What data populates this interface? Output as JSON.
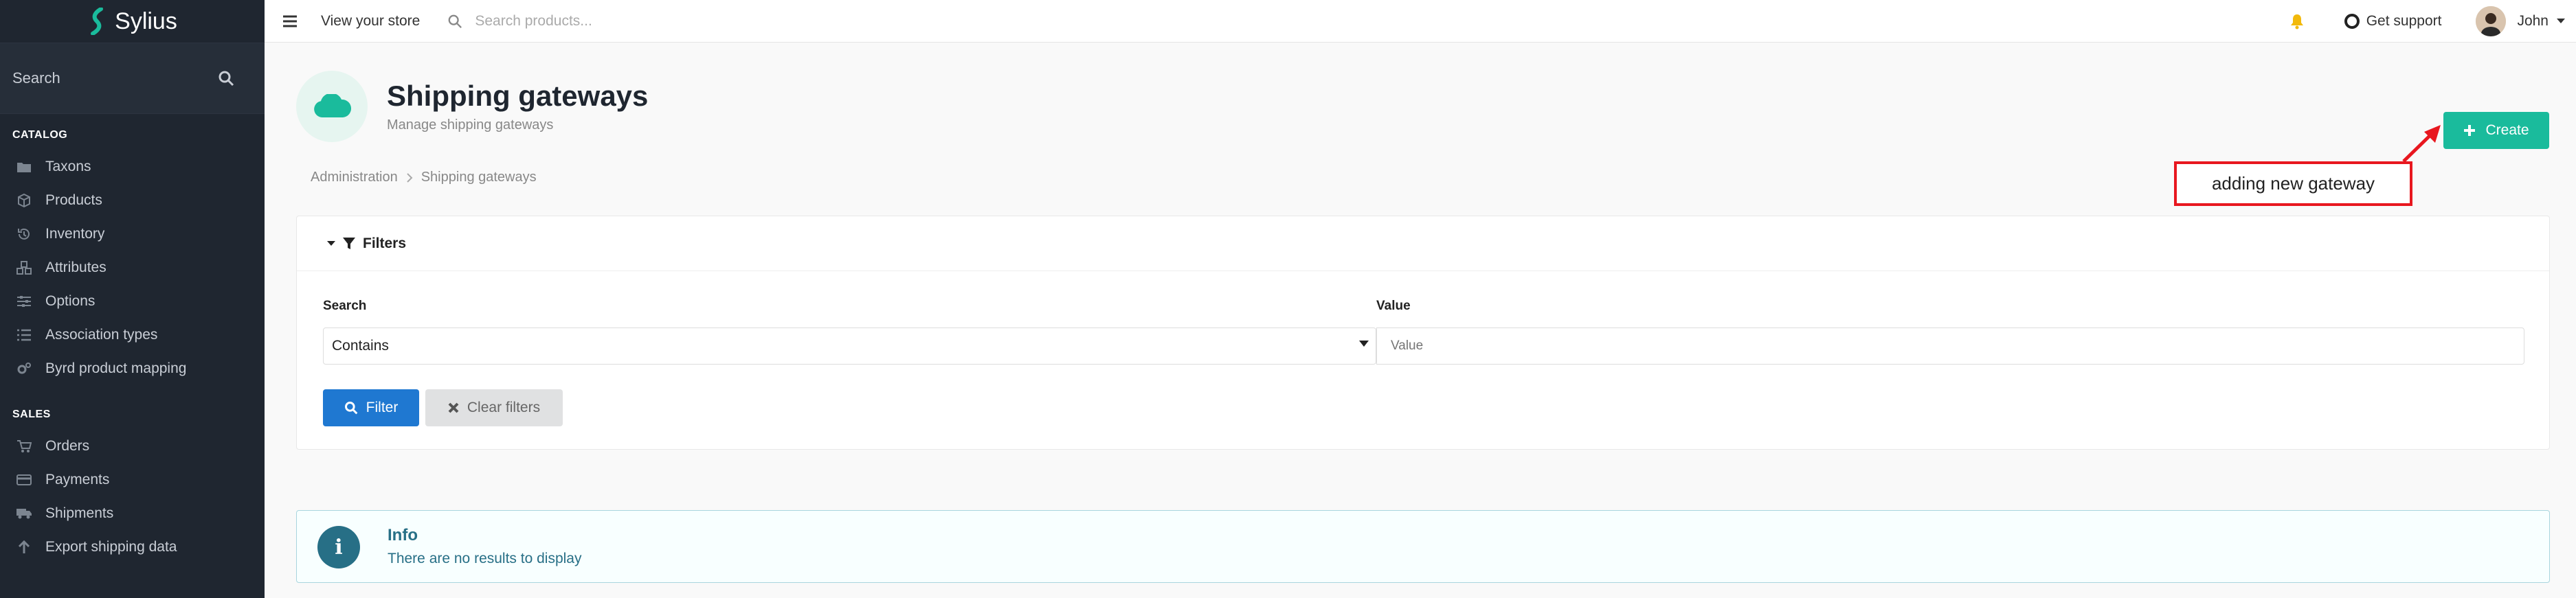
{
  "sidebar": {
    "brand": "Sylius",
    "search_label": "Search",
    "sections": [
      {
        "title": "CATALOG",
        "items": [
          {
            "label": "Taxons",
            "icon": "folder-icon"
          },
          {
            "label": "Products",
            "icon": "cube-icon"
          },
          {
            "label": "Inventory",
            "icon": "history-icon"
          },
          {
            "label": "Attributes",
            "icon": "cubes-icon"
          },
          {
            "label": "Options",
            "icon": "options-icon"
          },
          {
            "label": "Association types",
            "icon": "list-icon"
          },
          {
            "label": "Byrd product mapping",
            "icon": "cogs-icon"
          }
        ]
      },
      {
        "title": "SALES",
        "items": [
          {
            "label": "Orders",
            "icon": "cart-icon"
          },
          {
            "label": "Payments",
            "icon": "payment-icon"
          },
          {
            "label": "Shipments",
            "icon": "truck-icon"
          },
          {
            "label": "Export shipping data",
            "icon": "arrow-up-icon"
          }
        ]
      }
    ]
  },
  "topbar": {
    "view_store": "View your store",
    "search_placeholder": "Search products...",
    "support": "Get support",
    "user": "John"
  },
  "header": {
    "title": "Shipping gateways",
    "subtitle": "Manage shipping gateways",
    "breadcrumb": [
      "Administration",
      "Shipping gateways"
    ],
    "create_label": "Create"
  },
  "annotation": "adding new gateway",
  "filters": {
    "title": "Filters",
    "search_label": "Search",
    "search_value": "Contains",
    "value_label": "Value",
    "value_placeholder": "Value",
    "filter_button": "Filter",
    "clear_button": "Clear filters"
  },
  "info": {
    "title": "Info",
    "text": "There are no results to display"
  },
  "colors": {
    "sidebar_bg": "#1f2630",
    "accent": "#1abb9c",
    "primary": "#1f78d1",
    "info": "#276f86",
    "annotation": "#e8171f"
  }
}
